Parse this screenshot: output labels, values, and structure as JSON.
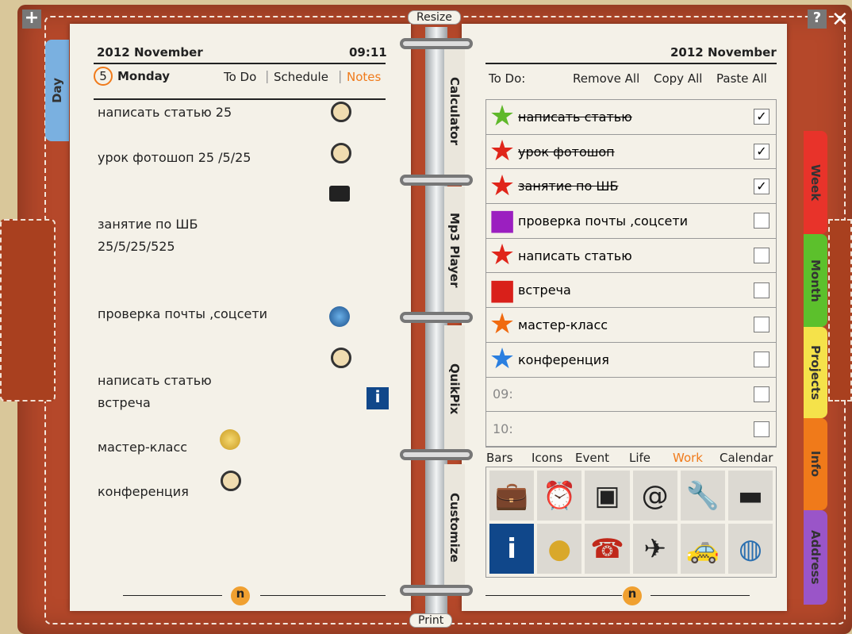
{
  "window": {
    "resize": "Resize",
    "print": "Print"
  },
  "left": {
    "year_month": "2012  November",
    "time": "09:11",
    "day_num": "5",
    "day_name": "Monday",
    "views": [
      "To Do",
      "Schedule",
      "Notes"
    ],
    "active_view": "Notes",
    "day_tab": "Day",
    "notes": [
      {
        "text": "написать статью  25",
        "icon": "alarm-clock"
      },
      {
        "text": "урок фотошоп  25 /5/25",
        "icon": "alarm-clock"
      },
      {
        "text": "",
        "icon": "briefcase"
      },
      {
        "text": "занятие по ШБ",
        "icon": null
      },
      {
        "text": " 25/5/25/525",
        "icon": null
      },
      {
        "text": "проверка почты ,соцсети",
        "icon": "globe"
      },
      {
        "text": "",
        "icon": "alarm-clock"
      },
      {
        "text": "написать статью",
        "icon": null
      },
      {
        "text": "встреча",
        "icon": "info"
      },
      {
        "text": "мастер-класс",
        "icon": "coin"
      },
      {
        "text": "конференция",
        "icon": "alarm-clock"
      }
    ]
  },
  "spine_tabs": [
    "Calculator",
    "Mp3 Player",
    "QuikPix",
    "Customize"
  ],
  "right": {
    "year_month": "2012  November",
    "todo_label": "To Do:",
    "actions": [
      "Remove All",
      "Copy All",
      "Paste All"
    ],
    "todos": [
      {
        "text": "написать статью",
        "marker": "star",
        "color": "#5fb82a",
        "done": true
      },
      {
        "text": "урок фотошоп",
        "marker": "star",
        "color": "#e0251a",
        "done": true
      },
      {
        "text": "занятие по ШБ",
        "marker": "star",
        "color": "#e0251a",
        "done": true
      },
      {
        "text": "проверка почты ,соцсети",
        "marker": "square",
        "color": "#9b1fc0",
        "done": false
      },
      {
        "text": "написать статью",
        "marker": "star",
        "color": "#e0251a",
        "done": false
      },
      {
        "text": "встреча",
        "marker": "square",
        "color": "#d9201a",
        "done": false
      },
      {
        "text": "мастер-класс",
        "marker": "star",
        "color": "#f06a10",
        "done": false
      },
      {
        "text": "конференция",
        "marker": "star",
        "color": "#2a7fe0",
        "done": false
      },
      {
        "text": "09:",
        "marker": null,
        "done": false
      },
      {
        "text": "10:",
        "marker": null,
        "done": false
      }
    ],
    "categories": [
      "Bars",
      "Icons",
      "Event",
      "Life",
      "Work",
      "Calendar"
    ],
    "active_category": "Work",
    "icons": [
      "briefcase",
      "alarm-clock",
      "computer",
      "at-sign",
      "wrench",
      "bed",
      "info",
      "coin",
      "telephone",
      "airplane",
      "taxi",
      "globe"
    ]
  },
  "side_tabs": [
    {
      "label": "Week",
      "color": "#e8332a"
    },
    {
      "label": "Month",
      "color": "#5cc02c"
    },
    {
      "label": "Projects",
      "color": "#f5e24a"
    },
    {
      "label": "Info",
      "color": "#f07a1a"
    },
    {
      "label": "Address",
      "color": "#9a55c8"
    }
  ],
  "colors": {
    "accent": "#f07a1a",
    "leather": "#b5482a"
  }
}
